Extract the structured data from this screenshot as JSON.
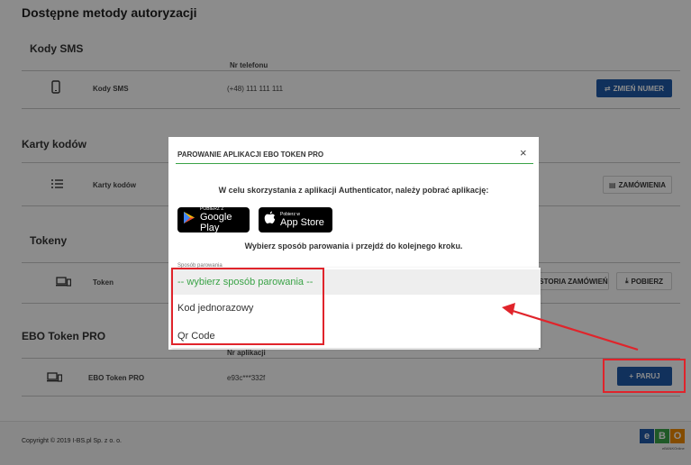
{
  "page": {
    "heading": "Dostępne metody autoryzacji"
  },
  "sms": {
    "title": "Kody SMS",
    "col_header": "Nr telefonu",
    "row_label": "Kody SMS",
    "phone": "(+48) 111 111 111",
    "button": "ZMIEŃ NUMER"
  },
  "cards": {
    "title": "Karty kodów",
    "row_label": "Karty kodów",
    "button": "ZAMÓWIENIA"
  },
  "tokens": {
    "title": "Tokeny",
    "row_label": "Token",
    "history_button": "STORIA ZAMÓWIEŃ",
    "download_button": "POBIERZ"
  },
  "ebo": {
    "title": "EBO Token PRO",
    "col_header": "Nr aplikacji",
    "row_label": "EBO Token PRO",
    "app_number": "e93c***332f",
    "button": "PARUJ"
  },
  "footer": {
    "copyright": "Copyright © 2019 I-BS.pl Sp. z o. o.",
    "logo_letters": [
      "e",
      "B",
      "O"
    ],
    "logo_sub": "eBANKOnline",
    "logo_colors": [
      "#1f5aa8",
      "#3aa347",
      "#f08a00"
    ]
  },
  "modal": {
    "title": "PAROWANIE APLIKACJI EBO TOKEN PRO",
    "close": "×",
    "instruction": "W celu skorzystania z aplikacji Authenticator, należy pobrać aplikację:",
    "google_small": "POBIERZ Z",
    "google_big": "Google Play",
    "apple_small": "Pobierz w",
    "apple_big": "App Store",
    "choose_text": "Wybierz sposób parowania i przejdź do kolejnego kroku.",
    "select_label": "Sposób parowania"
  },
  "dropdown": {
    "options": [
      "-- wybierz sposób parowania --",
      "Kod jednorazowy",
      "Qr Code"
    ],
    "selected_index": 0
  },
  "colors": {
    "accent_blue": "#1f5aa8",
    "accent_green": "#3aa347",
    "annotation_red": "#e0242b"
  }
}
